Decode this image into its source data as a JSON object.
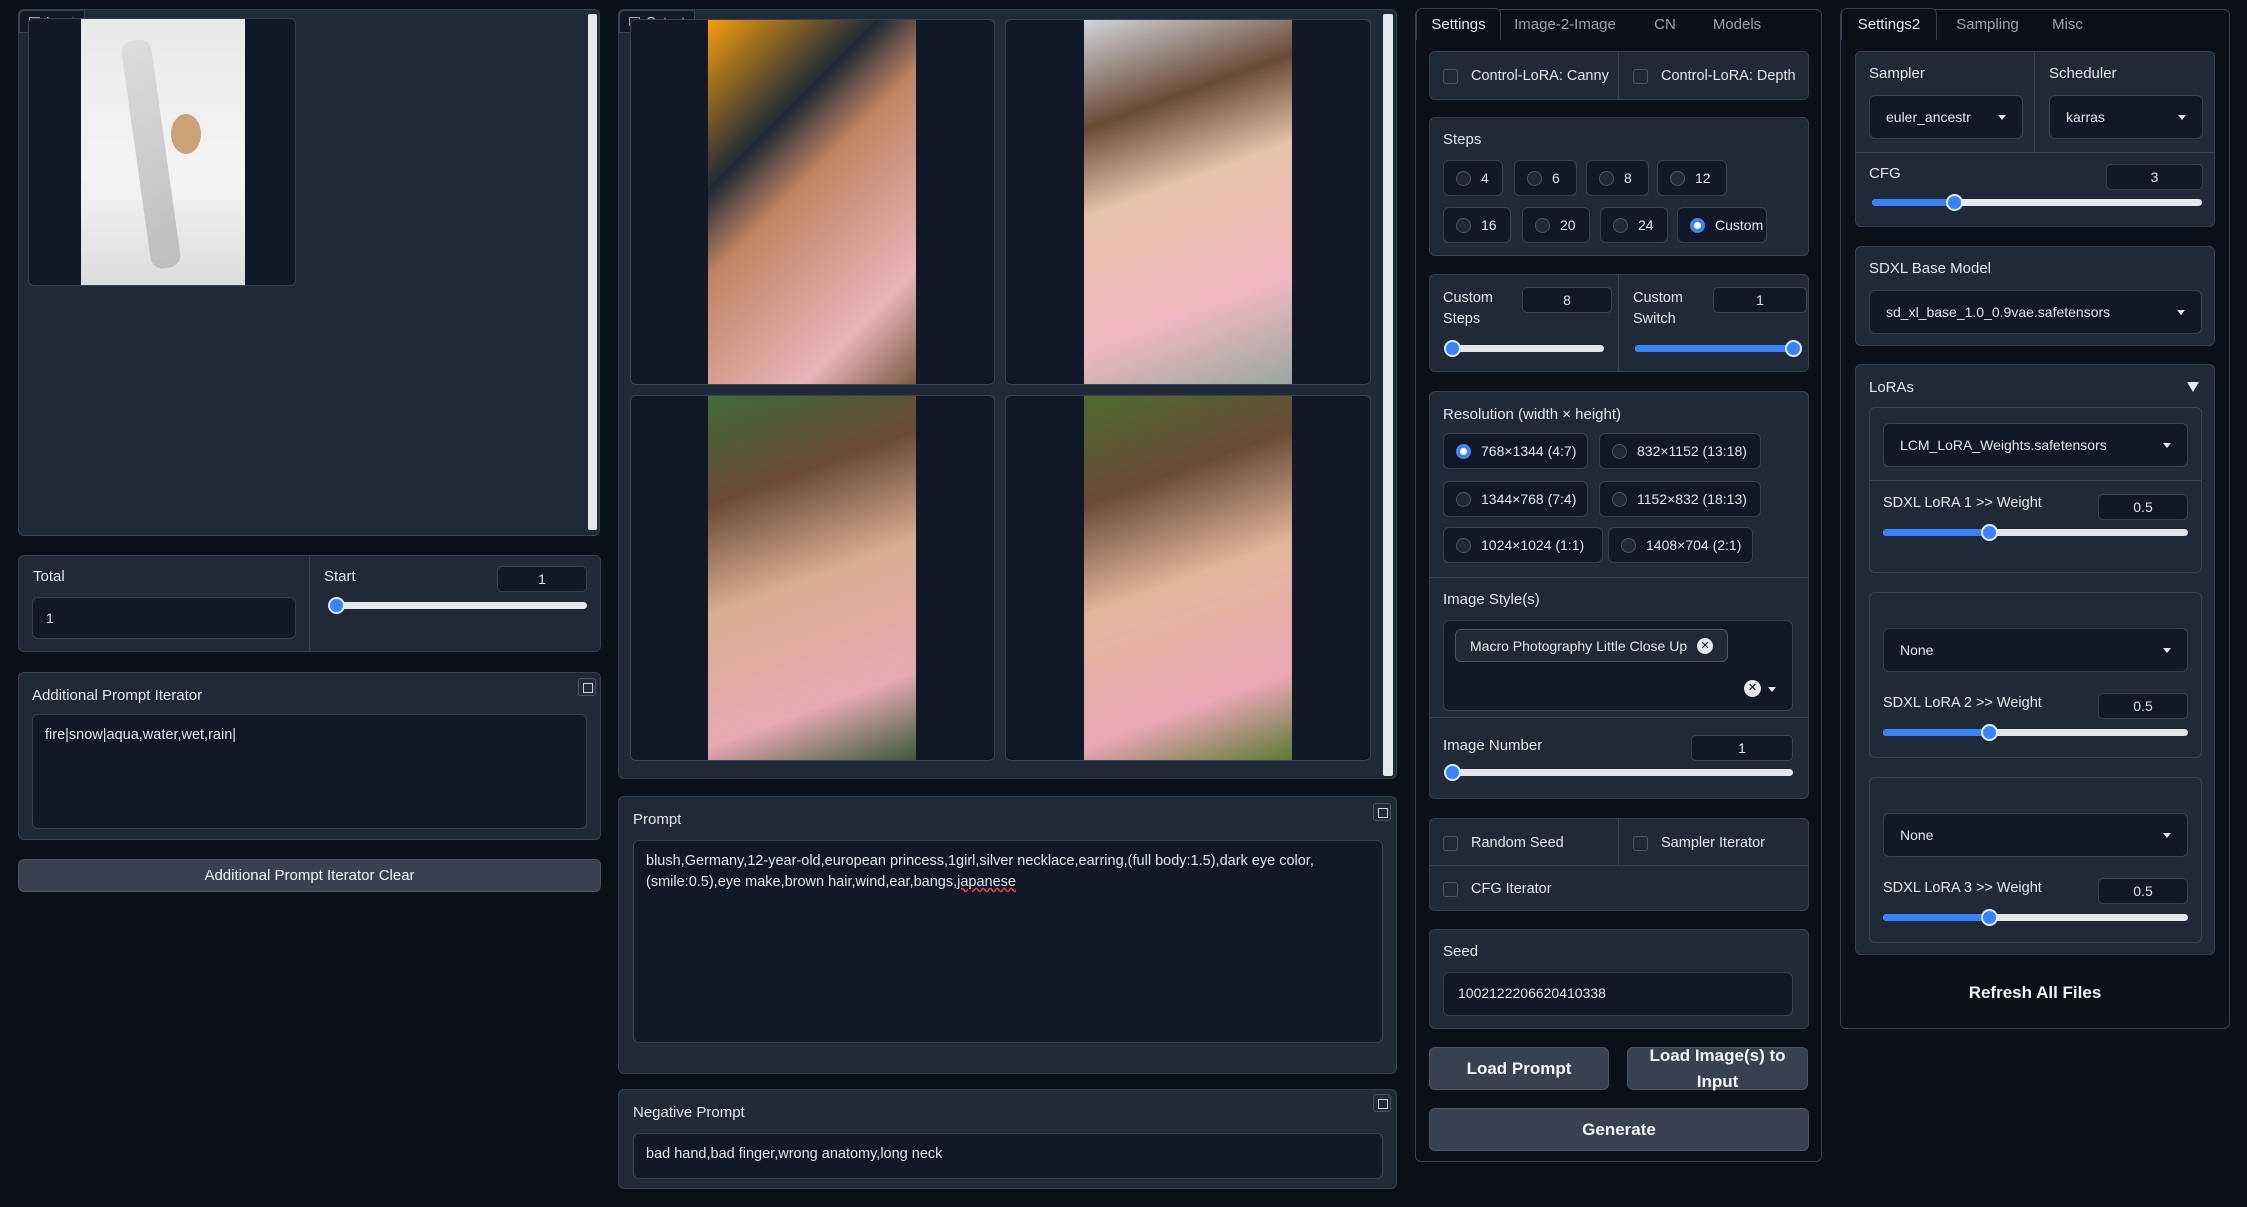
{
  "input_panel": {
    "label": "Input"
  },
  "output_panel": {
    "label": "Output"
  },
  "total": {
    "label": "Total",
    "value": "1"
  },
  "start": {
    "label": "Start",
    "value": "1",
    "level": 0
  },
  "iterator": {
    "label": "Additional Prompt Iterator",
    "value": "fire|snow|aqua,water,wet,rain|",
    "clear_label": "Additional Prompt Iterator Clear"
  },
  "prompt": {
    "label": "Prompt",
    "text1": "blush,Germany,12-year-old,european princess,1girl,silver necklace,earring,(full body:1.5),dark eye color,",
    "text2": "(smile:0.5),eye make,brown hair,wind,ear,bangs,",
    "text2b": "japanese"
  },
  "negative": {
    "label": "Negative Prompt",
    "value": "bad hand,bad finger,wrong anatomy,long neck"
  },
  "settings_tabs": [
    "Settings",
    "Image-2-Image",
    "CN",
    "Models"
  ],
  "control": {
    "canny": "Control-LoRA: Canny",
    "depth": "Control-LoRA: Depth"
  },
  "steps": {
    "label": "Steps",
    "options": [
      "4",
      "6",
      "8",
      "12",
      "16",
      "20",
      "24",
      "Custom"
    ],
    "selected": "Custom"
  },
  "custom_steps": {
    "label1": "Custom",
    "label2": "Steps",
    "value": "8",
    "level": 0
  },
  "custom_switch": {
    "label1": "Custom",
    "label2": "Switch",
    "value": "1",
    "level": 1
  },
  "resolution": {
    "label": "Resolution (width × height)",
    "options": [
      "768×1344 (4:7)",
      "832×1152 (13:18)",
      "1344×768 (7:4)",
      "1152×832 (18:13)",
      "1024×1024 (1:1)",
      "1408×704 (2:1)"
    ],
    "selected": "768×1344 (4:7)"
  },
  "image_style": {
    "label": "Image Style(s)",
    "chip": "Macro Photography Little Close Up"
  },
  "image_number": {
    "label": "Image Number",
    "value": "1",
    "level": 0
  },
  "checks": {
    "random_seed": "Random Seed",
    "sampler_iter": "Sampler Iterator",
    "cfg_iter": "CFG Iterator"
  },
  "seed": {
    "label": "Seed",
    "value": "1002122206620410338"
  },
  "buttons": {
    "load_prompt": "Load Prompt",
    "load_images": "Load Image(s) to Input",
    "generate": "Generate"
  },
  "settings2_tabs": [
    "Settings2",
    "Sampling",
    "Misc"
  ],
  "sampler": {
    "label": "Sampler",
    "value": "euler_ancestr"
  },
  "scheduler": {
    "label": "Scheduler",
    "value": "karras"
  },
  "cfg": {
    "label": "CFG",
    "value": "3",
    "level": 0.25
  },
  "base_model": {
    "label": "SDXL Base Model",
    "value": "sd_xl_base_1.0_0.9vae.safetensors"
  },
  "loras": {
    "label": "LoRAs",
    "items": [
      {
        "model": "LCM_LoRA_Weights.safetensors",
        "weight_label": "SDXL LoRA 1 >> Weight",
        "weight": "0.5",
        "level": 0.35
      },
      {
        "model": "None",
        "weight_label": "SDXL LoRA 2 >> Weight",
        "weight": "0.5",
        "level": 0.35
      },
      {
        "model": "None",
        "weight_label": "SDXL LoRA 3 >> Weight",
        "weight": "0.5",
        "level": 0.35
      }
    ]
  },
  "refresh": "Refresh All Files",
  "colors": {
    "accent": "#3b82f6",
    "panel": "#1f2937",
    "bg": "#0b0f19"
  }
}
